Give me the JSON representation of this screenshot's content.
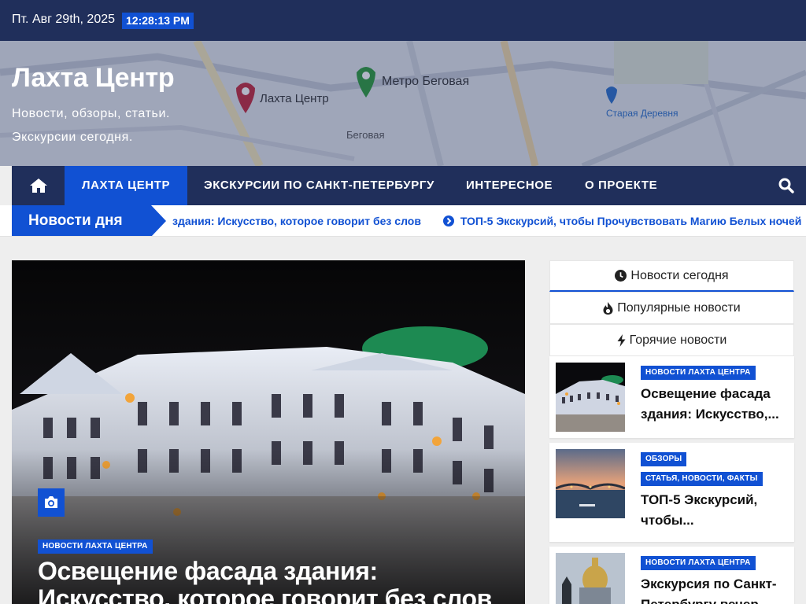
{
  "topbar": {
    "date": "Пт. Авг 29th, 2025",
    "time": "12:28:13 PM"
  },
  "site": {
    "title": "Лахта Центр",
    "description": "Новости, обзоры, статьи. Экскурсии сегодня."
  },
  "map_labels": {
    "lakhta": "Лахта Центр",
    "metro": "Метро Беговая",
    "begovaya": "Беговая",
    "staraya": "Старая Деревня"
  },
  "nav": {
    "home_icon": "home-icon",
    "items": [
      {
        "label": "ЛАХТА ЦЕНТР",
        "active": true
      },
      {
        "label": "ЭКСКУРСИИ ПО САНКТ-ПЕТЕРБУРГУ",
        "active": false
      },
      {
        "label": "ИНТЕРЕСНОЕ",
        "active": false
      },
      {
        "label": "О ПРОЕКТЕ",
        "active": false
      }
    ],
    "search_icon": "search-icon"
  },
  "ticker": {
    "label": "Новости дня",
    "items": [
      "здания: Искусство, которое говорит без слов",
      "ТОП-5 Экскурсий, чтобы Прочувствовать Магию Белых ночей"
    ]
  },
  "feature": {
    "category": "НОВОСТИ ЛАХТА ЦЕНТРА",
    "title": "Освещение фасада здания: Искусство, которое говорит без слов"
  },
  "sidebar": {
    "tabs": [
      {
        "label": "Новости сегодня",
        "icon": "clock-icon",
        "active": true
      },
      {
        "label": "Популярные новости",
        "icon": "fire-icon",
        "active": false
      },
      {
        "label": "Горячие новости",
        "icon": "bolt-icon",
        "active": false
      }
    ],
    "posts": [
      {
        "categories": [
          "НОВОСТИ ЛАХТА ЦЕНТРА"
        ],
        "title": "Освещение фасада здания: Искусство,..."
      },
      {
        "categories": [
          "ОБЗОРЫ",
          "СТАТЬЯ, НОВОСТИ, ФАКТЫ"
        ],
        "title": "ТОП-5 Экскурсий, чтобы..."
      },
      {
        "categories": [
          "НОВОСТИ ЛАХТА ЦЕНТРА"
        ],
        "title": "Экскурсия по Санкт-Петербургу вечер..."
      }
    ]
  },
  "colors": {
    "primary": "#1151d3",
    "dark": "#202f5b"
  }
}
